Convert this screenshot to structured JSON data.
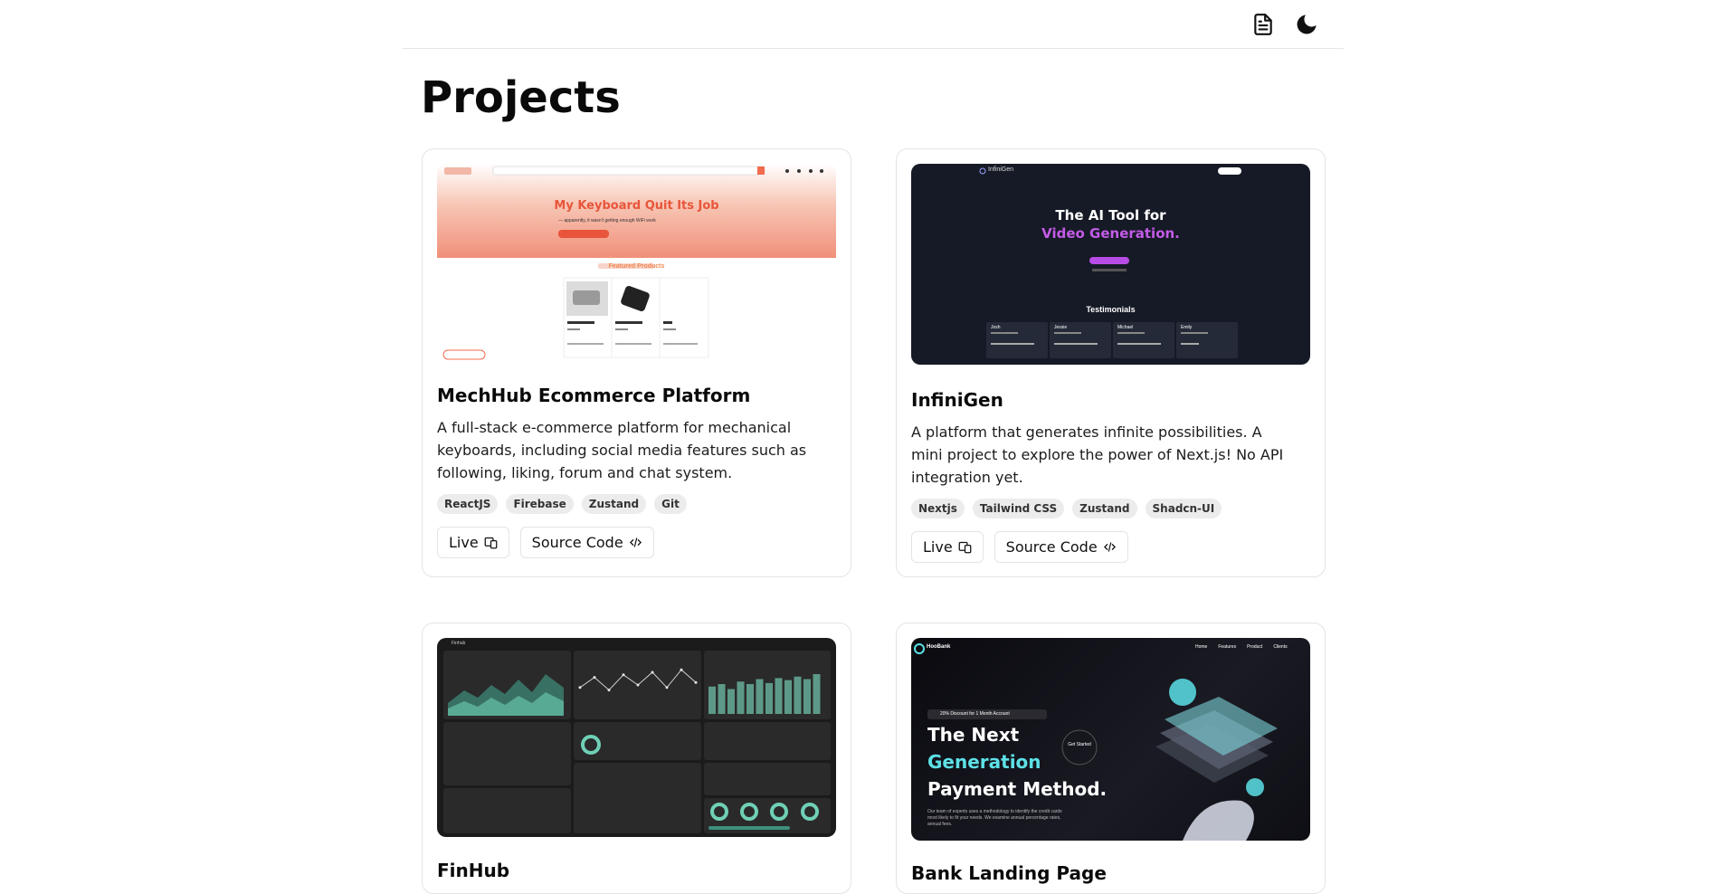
{
  "header": {
    "resume_icon": "document-icon",
    "theme_icon": "moon-icon"
  },
  "page_title": "Projects",
  "projects": [
    {
      "title": "MechHub Ecommerce Platform",
      "description": "A full-stack e-commerce platform for mechanical keyboards, including social media features such as following, liking, forum and chat system.",
      "tags": [
        "ReactJS",
        "Firebase",
        "Zustand",
        "Git"
      ],
      "live_label": "Live",
      "source_label": "Source Code",
      "thumbnail": {
        "headline": "My Keyboard Quit Its Job",
        "subline": "— apparently, it wasn't getting enough WiFi work",
        "section": "Featured Products",
        "products": [
          "akko plane pro",
          "Cannon G3 Slug",
          "xxx"
        ],
        "button": "+ New Listing"
      }
    },
    {
      "title": "InfiniGen",
      "description": "A platform that generates infinite possibilities. A mini project to explore the power of Next.js! No API integration yet.",
      "tags": [
        "Nextjs",
        "Tailwind CSS",
        "Zustand",
        "Shadcn-UI"
      ],
      "live_label": "Live",
      "source_label": "Source Code",
      "thumbnail": {
        "brand": "InfiniGen",
        "headline_1": "The AI Tool for",
        "headline_2": "Video Generation.",
        "section": "Testimonials",
        "people": [
          "Josh",
          "Jessie",
          "Michael",
          "Emily"
        ]
      }
    },
    {
      "title": "FinHub",
      "thumbnail": {
        "brand": "Finhub",
        "sparkline_values": [
          0.55,
          0.35,
          0.6,
          0.3,
          0.5,
          0.25,
          0.55,
          0.2,
          0.45
        ],
        "bar_values": [
          0.55,
          0.6,
          0.5,
          0.65,
          0.6,
          0.7,
          0.62,
          0.72,
          0.68,
          0.75,
          0.7,
          0.8
        ]
      }
    },
    {
      "title": "Bank Landing Page",
      "thumbnail": {
        "brand": "HooBank",
        "nav": [
          "Home",
          "Features",
          "Product",
          "Clients"
        ],
        "badge": "20% Discount for 1 Month Account",
        "headline_1": "The Next",
        "headline_2": "Generation",
        "headline_3": "Payment Method.",
        "cta": "Get Started",
        "body": "Our team of experts uses a methodology to identify the credit cards most likely to fit your needs. We examine annual percentage rates, annual fees."
      }
    }
  ],
  "colors": {
    "border": "#e4e4e7",
    "tag_bg": "#ececec",
    "mechhub_accent": "#f26b4f",
    "infinigen_accent": "#b84ce6",
    "hoobank_accent": "#5ce1e6"
  }
}
